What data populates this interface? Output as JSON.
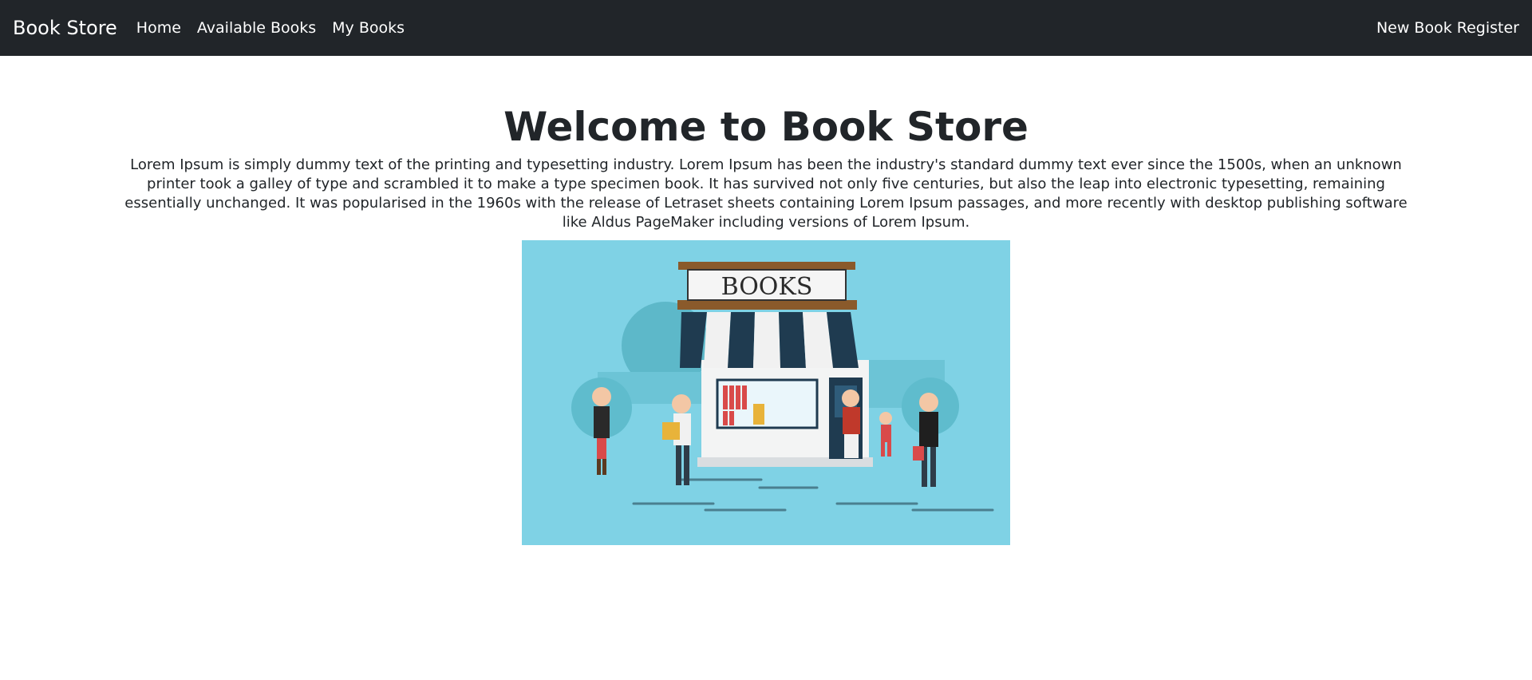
{
  "navbar": {
    "brand": "Book Store",
    "links": [
      "Home",
      "Available Books",
      "My Books"
    ],
    "right_link": "New Book Register"
  },
  "main": {
    "title": "Welcome to Book Store",
    "description": "Lorem Ipsum is simply dummy text of the printing and typesetting industry. Lorem Ipsum has been the industry's standard dummy text ever since the 1500s, when an unknown printer took a galley of type and scrambled it to make a type specimen book. It has survived not only five centuries, but also the leap into electronic typesetting, remaining essentially unchanged. It was popularised in the 1960s with the release of Letraset sheets containing Lorem Ipsum passages, and more recently with desktop publishing software like Aldus PageMaker including versions of Lorem Ipsum.",
    "illustration": {
      "sign_text": "BOOKS",
      "colors": {
        "background": "#7fd2e5",
        "awning_dark": "#1f3b50",
        "wood": "#8a5a2b",
        "accent_red": "#d94a4a"
      }
    }
  }
}
